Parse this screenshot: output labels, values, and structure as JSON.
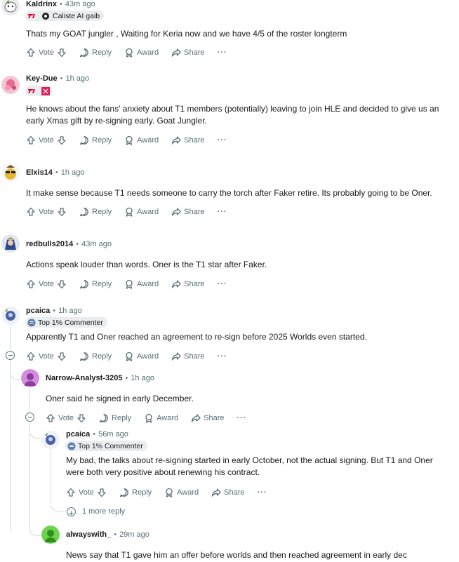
{
  "actions": {
    "vote": "Vote",
    "reply": "Reply",
    "award": "Award",
    "share": "Share",
    "more": "···"
  },
  "comments": [
    {
      "username": "Kaldrinx",
      "time": "43m ago",
      "flair": "Caliste AI gaib",
      "body": "Thats my GOAT jungler , Waiting for Keria now and we have 4/5 of the roster longterm"
    },
    {
      "username": "Key-Due",
      "time": "1h ago",
      "flair": "",
      "body_l1": "He knows about the fans' anxiety about T1 members (potentially) leaving to join HLE and decided to give us an",
      "body_l2": "early Xmas gift by re-signing early. Goat Jungler."
    },
    {
      "username": "Elxis14",
      "time": "1h ago",
      "body": "It make sense because T1 needs someone to carry the torch after Faker retire. Its probably going to be Oner."
    },
    {
      "username": "redbulls2014",
      "time": "43m ago",
      "body": "Actions speak louder than words. Oner is the T1 star after Faker."
    },
    {
      "username": "pcaica",
      "time": "1h ago",
      "flair": "Top 1% Commenter",
      "body": "Apparently T1 and Oner reached an agreement to re-sign before 2025 Worlds even started."
    },
    {
      "username": "Narrow-Analyst-3205",
      "time": "1h ago",
      "body": "Oner said he signed in early December."
    },
    {
      "username": "pcaica",
      "time": "56m ago",
      "flair": "Top 1% Commenter",
      "body_l1": "My bad, the talks about re-signing started in early October, not the actual signing. But T1 and Oner",
      "body_l2": "were both very positive about renewing his contract."
    },
    {
      "username": "alwayswith_",
      "time": "29m ago",
      "body": "News say that T1 gave him an offer before worlds and then reached agreement in early dec"
    }
  ],
  "more_replies": "1 more reply",
  "colors": {
    "meta": "#576f76",
    "thread": "#d5dadc",
    "flair_bg": "#eaedef",
    "t1_red": "#e2012d"
  }
}
